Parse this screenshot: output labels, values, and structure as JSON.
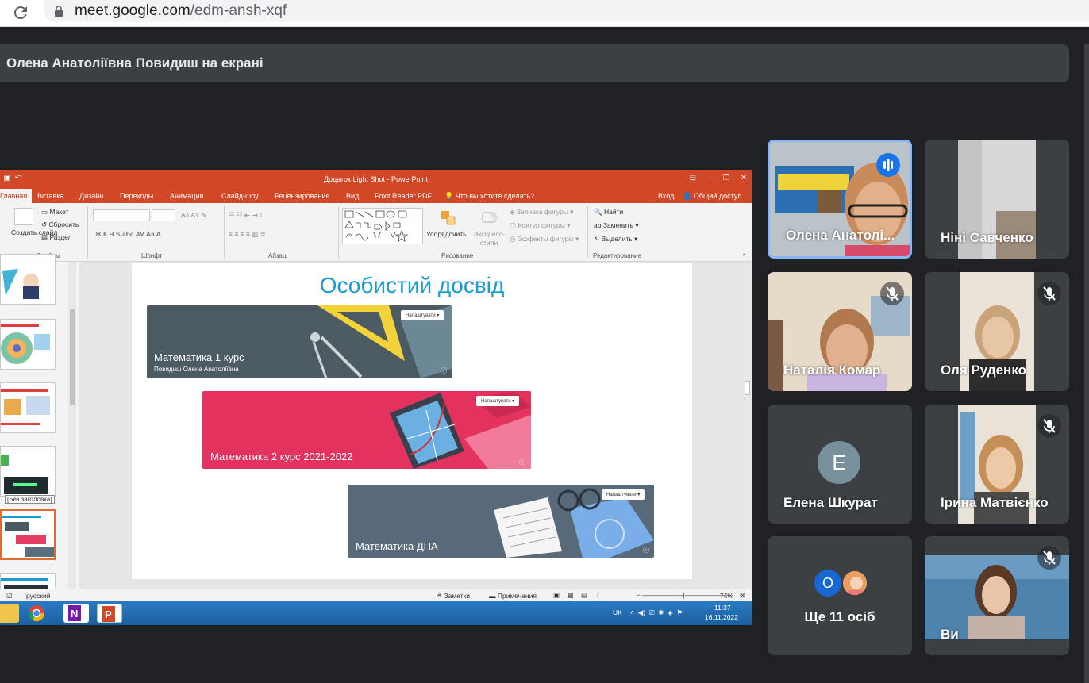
{
  "browser": {
    "url_host": "meet.google.com",
    "url_path": "/edm-ansh-xqf"
  },
  "banner": {
    "text": "Олена Анатоліївна Повидиш на екрані"
  },
  "powerpoint": {
    "window_title": "Додаток Light Shot - PowerPoint",
    "tabs": [
      "Главная",
      "Вставка",
      "Дизайн",
      "Переходы",
      "Анимация",
      "Слайд-шоу",
      "Рецензирование",
      "Вид",
      "Foxit Reader PDF"
    ],
    "tell_me": "Что вы хотите сделать?",
    "login": "Вход",
    "share": "Общий доступ",
    "ribbon": {
      "new_slide": "Создать слайд",
      "layout": "Макет",
      "reset": "Сбросить",
      "section": "Раздел",
      "group_slides": "Слайды",
      "group_font": "Шрифт",
      "group_paragraph": "Абзац",
      "group_drawing": "Рисование",
      "group_editing": "Редактирование",
      "arrange": "Упорядочить",
      "quick_styles": "Экспресс-стили",
      "fill": "Заливка фигуры",
      "outline": "Контур фигуры",
      "effects": "Эффекты фигуры",
      "find": "Найти",
      "replace": "Заменить",
      "select": "Выделить"
    },
    "thumb_tooltip": "[Без заголовка]",
    "slide": {
      "title": "Особистий досвід",
      "cards": [
        {
          "name": "Математика 1 курс",
          "sub": "Повидиш Олена Анатоліївна",
          "button": "Налаштувати"
        },
        {
          "name": "Математика 2 курс 2021-2022",
          "sub": "",
          "button": "Налаштувати"
        },
        {
          "name": "Математика ДПА",
          "sub": "",
          "button": "Налаштувати"
        }
      ]
    },
    "status": {
      "language": "русский",
      "notes": "Заметки",
      "comments": "Примечания",
      "zoom": "74%"
    },
    "taskbar": {
      "lang": "UK",
      "time": "11:37",
      "date": "16.11.2022"
    }
  },
  "participants": [
    {
      "name": "Олена Анатолі...",
      "speaking": true
    },
    {
      "name": "Ніні Савченко",
      "muted": false
    },
    {
      "name": "Наталія Комар",
      "muted": true
    },
    {
      "name": "Оля Руденко",
      "muted": true
    },
    {
      "name": "Елена Шкурат",
      "avatar_letter": "Е",
      "avatar_color": "#78909c"
    },
    {
      "name": "Ірина Матвієнко",
      "muted": true
    },
    {
      "name": "Ви",
      "muted": true
    }
  ],
  "more": {
    "avatar_letter": "О",
    "avatar_color": "#1967d2",
    "text": "Ще 11 осіб"
  }
}
